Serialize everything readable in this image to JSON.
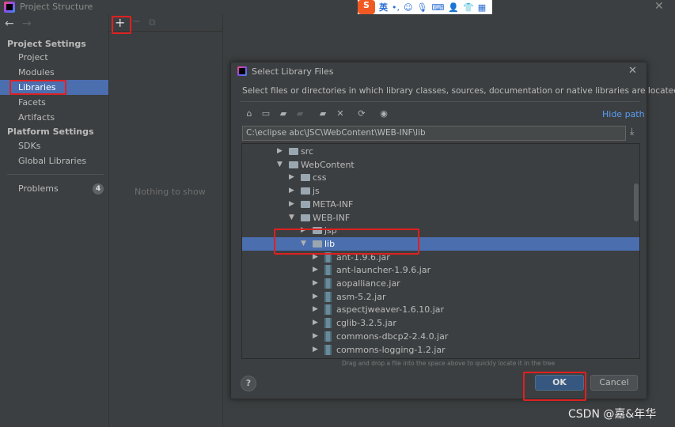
{
  "window": {
    "title": "Project Structure",
    "close_icon": "close-icon"
  },
  "ime_toolbar": {
    "logo": "S",
    "lang": "英",
    "items": [
      "punctuation-icon",
      "emoji-icon",
      "microphone-icon",
      "keyboard-icon",
      "user-icon",
      "skin-icon",
      "grid-icon"
    ]
  },
  "sidebar": {
    "back": "←",
    "forward": "→",
    "project_settings": "Project Settings",
    "project_items": [
      "Project",
      "Modules",
      "Libraries",
      "Facets",
      "Artifacts"
    ],
    "platform_settings": "Platform Settings",
    "platform_items": [
      "SDKs",
      "Global Libraries"
    ],
    "problems": "Problems",
    "problems_count": "4",
    "selected": "Libraries"
  },
  "midpanel": {
    "add": "+",
    "remove": "−",
    "copy": "⧉",
    "empty": "Nothing to show"
  },
  "dialog": {
    "title": "Select Library Files",
    "description": "Select files or directories in which library classes, sources, documentation or native libraries are located",
    "hide_path": "Hide path",
    "path": "C:\\eclipse abc\\JSC\\WebContent\\WEB-INF\\lib",
    "tree": [
      {
        "label": "src",
        "type": "folder",
        "level": 0,
        "expanded": false
      },
      {
        "label": "WebContent",
        "type": "folder",
        "level": 0,
        "expanded": true
      },
      {
        "label": "css",
        "type": "folder",
        "level": 1,
        "expanded": false
      },
      {
        "label": "js",
        "type": "folder",
        "level": 1,
        "expanded": false
      },
      {
        "label": "META-INF",
        "type": "folder",
        "level": 1,
        "expanded": false
      },
      {
        "label": "WEB-INF",
        "type": "folder",
        "level": 1,
        "expanded": true
      },
      {
        "label": "jsp",
        "type": "folder",
        "level": 2,
        "expanded": false
      },
      {
        "label": "lib",
        "type": "folder",
        "level": 2,
        "expanded": true,
        "selected": true
      },
      {
        "label": "ant-1.9.6.jar",
        "type": "jar",
        "level": 3
      },
      {
        "label": "ant-launcher-1.9.6.jar",
        "type": "jar",
        "level": 3
      },
      {
        "label": "aopalliance.jar",
        "type": "jar",
        "level": 3
      },
      {
        "label": "asm-5.2.jar",
        "type": "jar",
        "level": 3
      },
      {
        "label": "aspectjweaver-1.6.10.jar",
        "type": "jar",
        "level": 3
      },
      {
        "label": "cglib-3.2.5.jar",
        "type": "jar",
        "level": 3
      },
      {
        "label": "commons-dbcp2-2.4.0.jar",
        "type": "jar",
        "level": 3
      },
      {
        "label": "commons-logging-1.2.jar",
        "type": "jar",
        "level": 3
      }
    ],
    "hint": "Drag and drop a file into the space above to quickly locate it in the tree",
    "help": "?",
    "ok": "OK",
    "cancel": "Cancel"
  },
  "watermark": "CSDN @嘉&年华",
  "colors": {
    "selection": "#4b6eaf",
    "link": "#589df6",
    "highlight": "#e02020",
    "ok": "#365880"
  }
}
